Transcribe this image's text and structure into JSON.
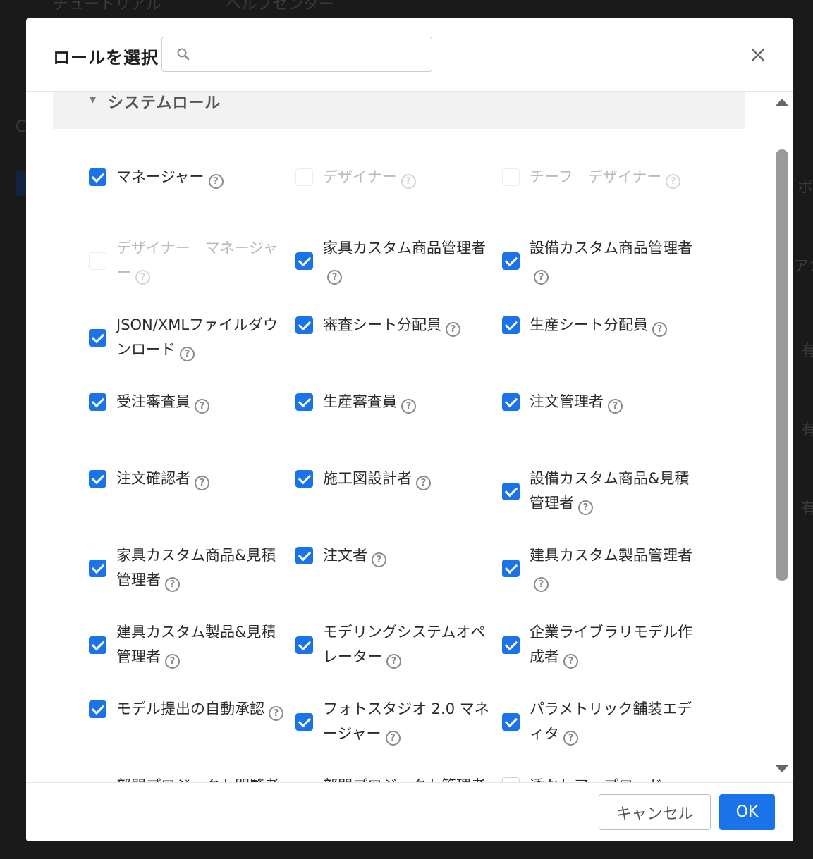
{
  "background": {
    "nav_items": [
      "チュートリアル",
      "ヘルプセンター"
    ],
    "fragments": [
      "C",
      "ボ",
      "アカ",
      "有",
      "有",
      "有"
    ]
  },
  "modal": {
    "title": "ロールを選択",
    "search": {
      "value": "",
      "placeholder": ""
    },
    "close_icon": "close-icon",
    "group": {
      "title": "システムロール",
      "expanded": true
    },
    "roles": [
      {
        "label": "マネージャー",
        "checked": true,
        "disabled": false
      },
      {
        "label": "デザイナー",
        "checked": false,
        "disabled": true
      },
      {
        "label": "チーフ　デザイナー",
        "checked": false,
        "disabled": true
      },
      {
        "label": "デザイナー　マネージャー",
        "checked": false,
        "disabled": true
      },
      {
        "label": "家具カスタム商品管理者",
        "checked": true,
        "disabled": false
      },
      {
        "label": "設備カスタム商品管理者",
        "checked": true,
        "disabled": false
      },
      {
        "label": "JSON/XMLファイルダウンロード",
        "checked": true,
        "disabled": false
      },
      {
        "label": "審査シート分配員",
        "checked": true,
        "disabled": false
      },
      {
        "label": "生産シート分配員",
        "checked": true,
        "disabled": false
      },
      {
        "label": "受注審査員",
        "checked": true,
        "disabled": false
      },
      {
        "label": "生産審査員",
        "checked": true,
        "disabled": false
      },
      {
        "label": "注文管理者",
        "checked": true,
        "disabled": false
      },
      {
        "label": "注文確認者",
        "checked": true,
        "disabled": false
      },
      {
        "label": "施工図設計者",
        "checked": true,
        "disabled": false
      },
      {
        "label": "設備カスタム商品&見積管理者",
        "checked": true,
        "disabled": false
      },
      {
        "label": "家具カスタム商品&見積管理者",
        "checked": true,
        "disabled": false
      },
      {
        "label": "注文者",
        "checked": true,
        "disabled": false
      },
      {
        "label": "建具カスタム製品管理者",
        "checked": true,
        "disabled": false
      },
      {
        "label": "建具カスタム製品&見積管理者",
        "checked": true,
        "disabled": false
      },
      {
        "label": "モデリングシステムオペレーター",
        "checked": true,
        "disabled": false
      },
      {
        "label": "企業ライブラリモデル作成者",
        "checked": true,
        "disabled": false
      },
      {
        "label": "モデル提出の自動承認",
        "checked": true,
        "disabled": false
      },
      {
        "label": "フォトスタジオ 2.0 マネージャー",
        "checked": true,
        "disabled": false
      },
      {
        "label": "パラメトリック舗装エディタ",
        "checked": true,
        "disabled": false
      },
      {
        "label": "部門プロジェクト閲覧者",
        "checked": true,
        "disabled": false
      },
      {
        "label": "部門プロジェクト管理者",
        "checked": true,
        "disabled": false
      },
      {
        "label": "透かしアップロード",
        "checked": false,
        "disabled": false
      }
    ],
    "help_glyph": "?",
    "footer": {
      "cancel_label": "キャンセル",
      "ok_label": "OK"
    }
  },
  "colors": {
    "accent": "#1a73e8",
    "overlay": "#1a1a1a"
  }
}
